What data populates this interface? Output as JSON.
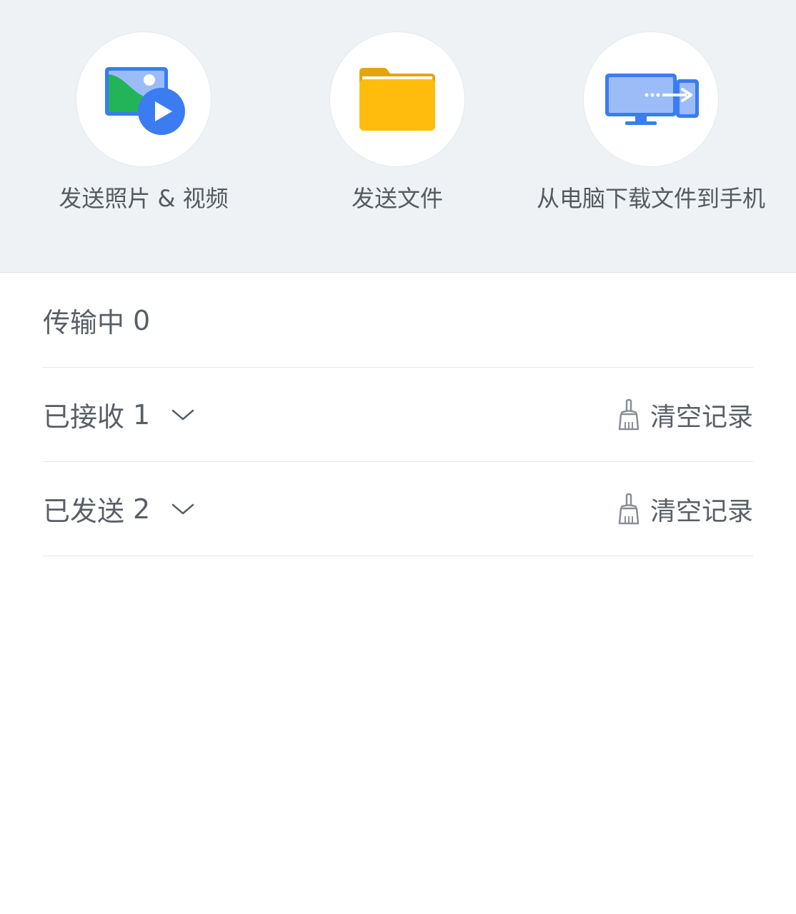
{
  "actions": [
    {
      "label": "发送照片 & 视频",
      "icon": "photo-video-icon"
    },
    {
      "label": "发送文件",
      "icon": "folder-icon"
    },
    {
      "label": "从电脑下载文件到手机",
      "icon": "computer-to-phone-icon"
    }
  ],
  "list": {
    "transferring": {
      "label": "传输中",
      "count": "0"
    },
    "received": {
      "label": "已接收",
      "count": "1",
      "clear_label": "清空记录"
    },
    "sent": {
      "label": "已发送",
      "count": "2",
      "clear_label": "清空记录"
    }
  },
  "colors": {
    "panel_bg": "#eef2f5",
    "blue": "#3b7cf0",
    "light_blue": "#9bbcf7",
    "green": "#23b45a",
    "folder_yellow": "#ffbc0d",
    "folder_dark": "#e3a60a",
    "text": "#5a5f66"
  }
}
